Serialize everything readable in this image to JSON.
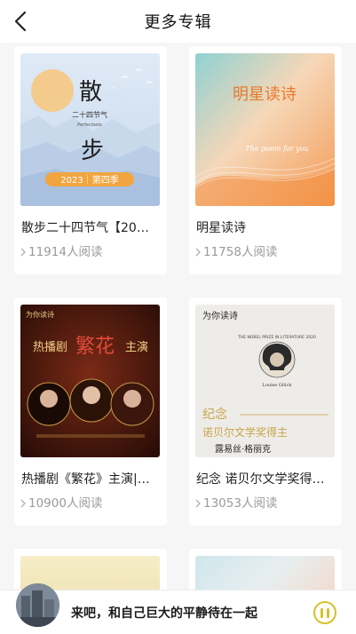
{
  "header": {
    "title": "更多专辑",
    "back_icon": "back-chevron-icon"
  },
  "albums": [
    {
      "title": "散步二十四节气【20…",
      "reads": "11914人阅读",
      "cover": {
        "main": "散",
        "main2": "步",
        "sub": "二十四节气",
        "sub_en": "Perfectsolo",
        "badge": "2023｜第四季"
      }
    },
    {
      "title": "明星读诗",
      "reads": "11758人阅读",
      "cover": {
        "main": "明星读诗",
        "sub": "The poem for you"
      }
    },
    {
      "title": "热播剧《繁花》主演|…",
      "reads": "10900人阅读",
      "cover": {
        "brand": "为你读诗",
        "main": "热播剧",
        "main2": "繁花",
        "main3": "主演"
      }
    },
    {
      "title": "纪念 诺贝尔文学奖得…",
      "reads": "13053人阅读",
      "cover": {
        "brand": "为你读诗",
        "prize": "THE NOBEL PRIZE IN LITERATURE 2020",
        "name_en": "Louise Glück",
        "main": "纪念",
        "main2": "诺贝尔文学奖得主",
        "main3": "露易丝·格丽克"
      }
    }
  ],
  "player": {
    "track": "来吧，和自己巨大的平静待在一起",
    "pause_icon": "pause-icon",
    "accent": "#d6c12a"
  }
}
